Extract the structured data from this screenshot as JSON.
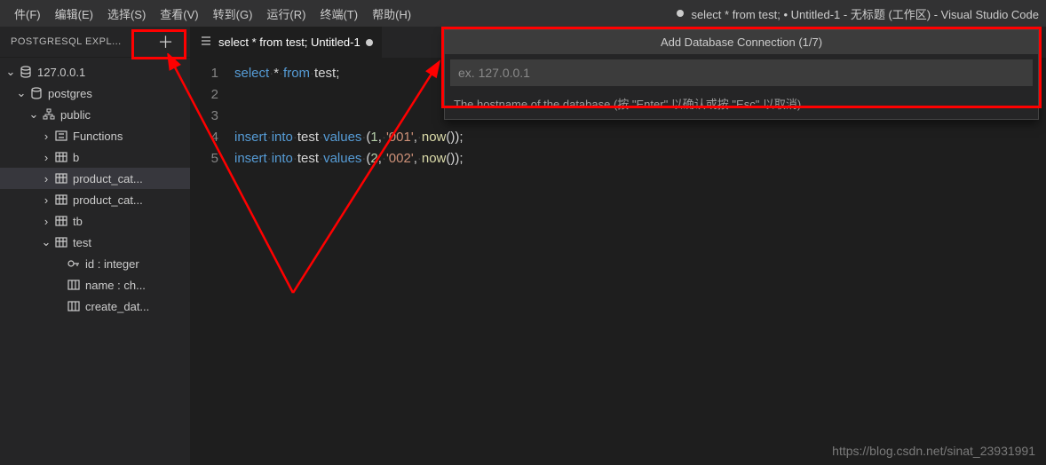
{
  "menu": {
    "items": [
      "件(F)",
      "编辑(E)",
      "选择(S)",
      "查看(V)",
      "转到(G)",
      "运行(R)",
      "终端(T)",
      "帮助(H)"
    ],
    "title": "select * from test; • Untitled-1 - 无标题 (工作区) - Visual Studio Code"
  },
  "sidebar": {
    "title": "POSTGRESQL EXPL...",
    "tree": {
      "server": "127.0.0.1",
      "database": "postgres",
      "schema": "public",
      "functions": "Functions",
      "tables": [
        "b",
        "product_cat...",
        "product_cat...",
        "tb",
        "test"
      ],
      "columns": [
        "id : integer",
        "name : ch...",
        "create_dat..."
      ]
    }
  },
  "tab": {
    "label": "select * from test;  Untitled-1"
  },
  "code": {
    "lines": [
      {
        "n": "1",
        "p": [
          {
            "t": "select",
            "c": "kw"
          },
          {
            "t": "·",
            "c": "ws"
          },
          {
            "t": "*",
            "c": "op"
          },
          {
            "t": "·",
            "c": "ws"
          },
          {
            "t": "from",
            "c": "kw"
          },
          {
            "t": "·",
            "c": "ws"
          },
          {
            "t": "test",
            "c": "op"
          },
          {
            "t": ";",
            "c": "op"
          }
        ]
      },
      {
        "n": "2",
        "p": []
      },
      {
        "n": "3",
        "p": []
      },
      {
        "n": "4",
        "p": [
          {
            "t": "insert",
            "c": "kw"
          },
          {
            "t": "·",
            "c": "ws"
          },
          {
            "t": "into",
            "c": "kw"
          },
          {
            "t": "·",
            "c": "ws"
          },
          {
            "t": "test",
            "c": "op"
          },
          {
            "t": "·",
            "c": "ws"
          },
          {
            "t": "values",
            "c": "kw"
          },
          {
            "t": "·",
            "c": "ws"
          },
          {
            "t": "(",
            "c": "op"
          },
          {
            "t": "1",
            "c": "num"
          },
          {
            "t": ",",
            "c": "op"
          },
          {
            "t": "·",
            "c": "ws"
          },
          {
            "t": "'001'",
            "c": "str"
          },
          {
            "t": ",",
            "c": "op"
          },
          {
            "t": "·",
            "c": "ws"
          },
          {
            "t": "now",
            "c": "fn"
          },
          {
            "t": "());",
            "c": "op"
          }
        ]
      },
      {
        "n": "5",
        "p": [
          {
            "t": "insert",
            "c": "kw"
          },
          {
            "t": "·",
            "c": "ws"
          },
          {
            "t": "into",
            "c": "kw"
          },
          {
            "t": "·",
            "c": "ws"
          },
          {
            "t": "test",
            "c": "op"
          },
          {
            "t": "·",
            "c": "ws"
          },
          {
            "t": "values",
            "c": "kw"
          },
          {
            "t": "·",
            "c": "ws"
          },
          {
            "t": "(",
            "c": "op"
          },
          {
            "t": "2",
            "c": "num"
          },
          {
            "t": ",",
            "c": "op"
          },
          {
            "t": "·",
            "c": "ws"
          },
          {
            "t": "'002'",
            "c": "str"
          },
          {
            "t": ",",
            "c": "op"
          },
          {
            "t": "·",
            "c": "ws"
          },
          {
            "t": "now",
            "c": "fn"
          },
          {
            "t": "());",
            "c": "op"
          }
        ]
      }
    ]
  },
  "quickinput": {
    "title": "Add Database Connection (1/7)",
    "placeholder": "ex. 127.0.0.1",
    "hint": "The hostname of the database (按 \"Enter\" 以确认或按 \"Esc\" 以取消)"
  },
  "watermark": "https://blog.csdn.net/sinat_23931991"
}
